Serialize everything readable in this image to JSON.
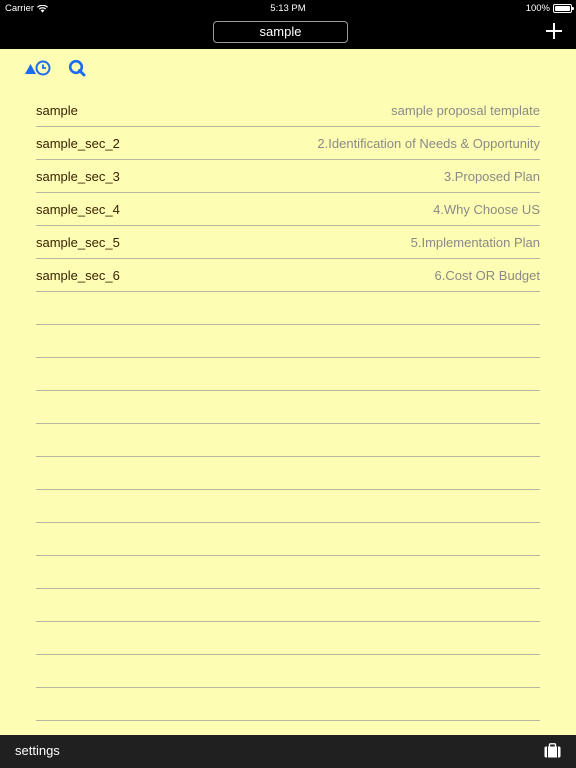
{
  "status_bar": {
    "carrier": "Carrier",
    "time": "5:13 PM",
    "battery_text": "100%"
  },
  "nav": {
    "title": "sample",
    "add_icon": "plus-icon"
  },
  "toolbar": {
    "sort_icon": "sort-by-time-icon",
    "search_icon": "search-icon",
    "accent_color": "#1a6cf0"
  },
  "list": {
    "rows": [
      {
        "name": "sample",
        "desc": "sample proposal template"
      },
      {
        "name": "sample_sec_2",
        "desc": "2.Identification of Needs & Opportunity"
      },
      {
        "name": "sample_sec_3",
        "desc": "3.Proposed Plan"
      },
      {
        "name": "sample_sec_4",
        "desc": "4.Why Choose US"
      },
      {
        "name": "sample_sec_5",
        "desc": "5.Implementation Plan"
      },
      {
        "name": "sample_sec_6",
        "desc": "6.Cost OR Budget"
      }
    ]
  },
  "bottom_bar": {
    "settings_label": "settings",
    "briefcase_icon": "briefcase-icon"
  },
  "colors": {
    "background": "#fefdb4",
    "bars": "#000000",
    "bottom_bar": "#202020"
  }
}
